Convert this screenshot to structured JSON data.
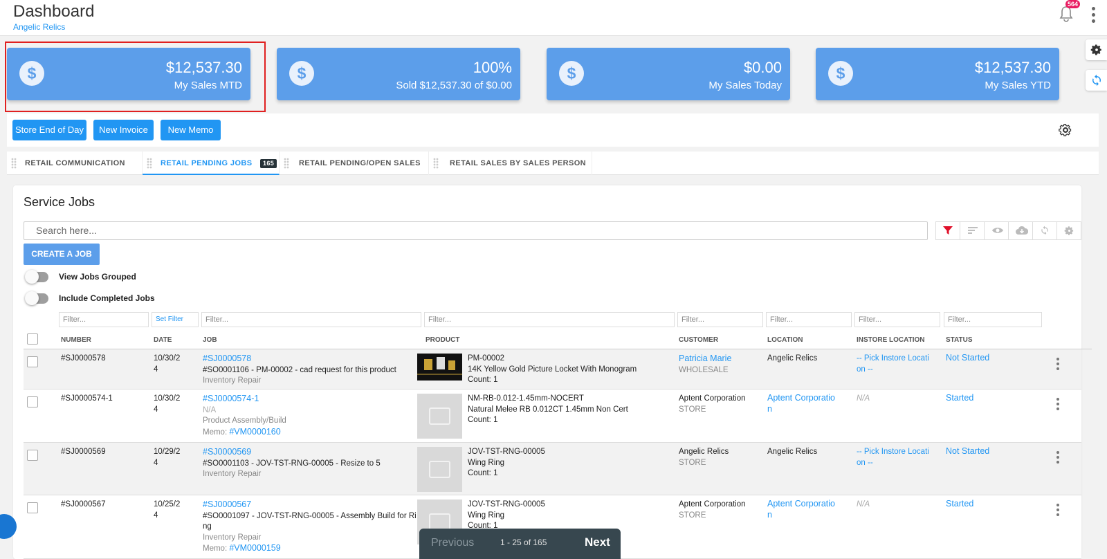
{
  "header": {
    "title": "Dashboard",
    "subtitle": "Angelic Relics",
    "notification_count": "564"
  },
  "cards": [
    {
      "value": "$12,537.30",
      "label": "My Sales MTD",
      "icon": "dollar-icon"
    },
    {
      "value": "100%",
      "label": "Sold $12,537.30 of $0.00",
      "icon": "dollar-icon"
    },
    {
      "value": "$0.00",
      "label": "My Sales Today",
      "icon": "dollar-icon"
    },
    {
      "value": "$12,537.30",
      "label": "My Sales YTD",
      "icon": "dollar-icon"
    }
  ],
  "toolbar": {
    "store_end_of_day": "Store End of Day",
    "new_invoice": "New Invoice",
    "new_memo": "New Memo"
  },
  "tabs": [
    {
      "label": "RETAIL COMMUNICATION"
    },
    {
      "label": "RETAIL PENDING JOBS",
      "count": "165"
    },
    {
      "label": "RETAIL PENDING/OPEN SALES"
    },
    {
      "label": "RETAIL SALES BY SALES PERSON"
    }
  ],
  "panel": {
    "title": "Service Jobs",
    "search_placeholder": "Search here...",
    "create_label": "CREATE A JOB",
    "toggle_grouped": "View Jobs Grouped",
    "toggle_completed": "Include Completed Jobs",
    "filter_placeholder": "Filter...",
    "set_filter": "Set Filter"
  },
  "columns": [
    "NUMBER",
    "DATE",
    "JOB",
    "PRODUCT",
    "CUSTOMER",
    "LOCATION",
    "INSTORE LOCATION",
    "STATUS"
  ],
  "rows": [
    {
      "number": "#SJ0000578",
      "date1": "10/30/2",
      "date2": "4",
      "job_link": "#SJ0000578",
      "job_desc": "#SO0001106 - PM-00002 - cad request for this product",
      "job_type": "Inventory Repair",
      "product_sku": "PM-00002",
      "product_name": "14K Yellow Gold Picture Locket With Monogram",
      "product_count": "Count: 1",
      "customer": "Patricia Marie",
      "customer_type": "WHOLESALE",
      "location": "Angelic Relics",
      "instore1": "-- Pick Instore Locati",
      "instore2": "on --",
      "status": "Not Started"
    },
    {
      "number": "#SJ0000574-1",
      "date1": "10/30/2",
      "date2": "4",
      "job_link": "#SJ0000574-1",
      "job_desc": "N/A",
      "job_type": "Product Assembly/Build",
      "memo_label": "Memo: ",
      "memo_link": "#VM0000160",
      "product_sku": "NM-RB-0.012-1.45mm-NOCERT",
      "product_name": "Natural Melee RB 0.012CT 1.45mm Non Cert",
      "product_count": "Count: 1",
      "customer": "Aptent Corporation",
      "customer_type": "STORE",
      "location1": "Aptent Corporatio",
      "location2": "n",
      "instore": "N/A",
      "status": "Started"
    },
    {
      "number": "#SJ0000569",
      "date1": "10/29/2",
      "date2": "4",
      "job_link": "#SJ0000569",
      "job_desc": "#SO0001103 - JOV-TST-RNG-00005 - Resize to 5",
      "job_type": "Inventory Repair",
      "product_sku": "JOV-TST-RNG-00005",
      "product_name": "Wing Ring",
      "product_count": "Count: 1",
      "customer": "Angelic Relics",
      "customer_type": "STORE",
      "location": "Angelic Relics",
      "instore1": "-- Pick Instore Locati",
      "instore2": "on --",
      "status": "Not Started"
    },
    {
      "number": "#SJ0000567",
      "date1": "10/25/2",
      "date2": "4",
      "job_link": "#SJ0000567",
      "job_desc1": "#SO0001097 - JOV-TST-RNG-00005 - Assembly Build for Ri",
      "job_desc2": "ng",
      "job_type": "Inventory Repair",
      "memo_label": "Memo: ",
      "memo_link": "#VM0000159",
      "product_sku": "JOV-TST-RNG-00005",
      "product_name": "Wing Ring",
      "product_count": "Count: 1",
      "customer": "Aptent Corporation",
      "customer_type": "STORE",
      "location1": "Aptent Corporatio",
      "location2": "n",
      "instore": "N/A",
      "status": "Started"
    }
  ],
  "pager": {
    "previous": "Previous",
    "info": "1 - 25 of 165",
    "next": "Next"
  }
}
